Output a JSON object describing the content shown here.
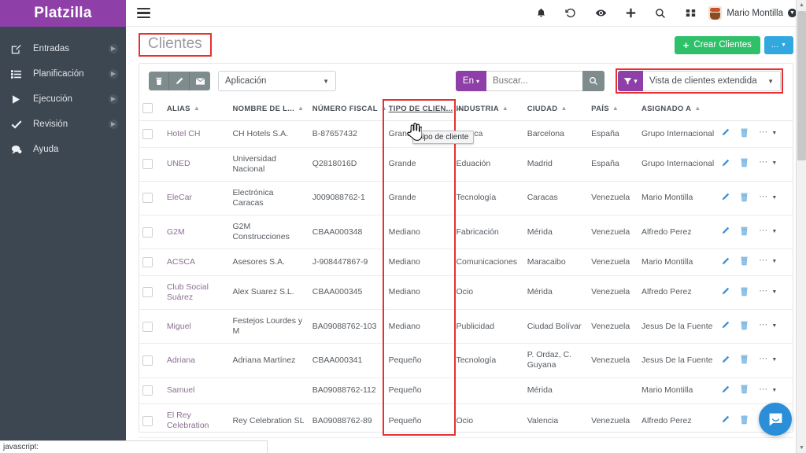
{
  "brand": {
    "logo": "Platzilla"
  },
  "sidebar": {
    "items": [
      {
        "label": "Entradas",
        "icon": "edit-square-icon",
        "has_arrow": true
      },
      {
        "label": "Planificación",
        "icon": "list-icon",
        "has_arrow": true
      },
      {
        "label": "Ejecución",
        "icon": "play-icon",
        "has_arrow": true
      },
      {
        "label": "Revisión",
        "icon": "check-icon",
        "has_arrow": true
      },
      {
        "label": "Ayuda",
        "icon": "chat-bubble-icon",
        "has_arrow": false
      }
    ]
  },
  "topbar": {
    "menu_icon": "hamburger-icon",
    "icons": [
      "bell-icon",
      "history-icon",
      "eye-icon",
      "plus-icon",
      "search-icon",
      "grid-icon"
    ],
    "username": "Mario Montilla",
    "avatar": "user-avatar"
  },
  "page": {
    "title": "Clientes",
    "create_button": "Crear Clientes",
    "create_more_button": "..."
  },
  "toolbar": {
    "delete_icon": "trash-icon",
    "edit_icon": "pencil-icon",
    "mail_icon": "envelope-icon",
    "app_select": "Aplicación",
    "lang_button": "En",
    "search_placeholder": "Buscar...",
    "search_value": "",
    "search_icon": "search-icon",
    "filter_icon": "funnel-icon",
    "view_select": "Vista de clientes extendida"
  },
  "table": {
    "columns": [
      {
        "key": "check",
        "label": "",
        "sortable": false
      },
      {
        "key": "alias",
        "label": "ALIAS",
        "sortable": true
      },
      {
        "key": "nombre",
        "label": "NOMBRE DE L...",
        "sortable": true
      },
      {
        "key": "fiscal",
        "label": "NÚMERO FISCAL",
        "sortable": true
      },
      {
        "key": "tipo",
        "label": "TIPO DE CLIEN...",
        "sortable": true
      },
      {
        "key": "industria",
        "label": "INDUSTRIA",
        "sortable": true
      },
      {
        "key": "ciudad",
        "label": "CIUDAD",
        "sortable": true
      },
      {
        "key": "pais",
        "label": "PAÍS",
        "sortable": true
      },
      {
        "key": "asignado",
        "label": "ASIGNADO A",
        "sortable": true
      }
    ],
    "rows": [
      {
        "alias": "Hotel CH",
        "nombre": "CH Hotels S.A.",
        "fiscal": "B-87657432",
        "tipo": "Grande",
        "industria": "Horeca",
        "ciudad": "Barcelona",
        "pais": "España",
        "asignado": "Grupo Internacional"
      },
      {
        "alias": "UNED",
        "nombre": "Universidad Nacional",
        "fiscal": "Q2818016D",
        "tipo": "Grande",
        "industria": "Eduación",
        "ciudad": "Madrid",
        "pais": "España",
        "asignado": "Grupo Internacional"
      },
      {
        "alias": "EleCar",
        "nombre": "Electrónica Caracas",
        "fiscal": "J009088762-1",
        "tipo": "Grande",
        "industria": "Tecnología",
        "ciudad": "Caracas",
        "pais": "Venezuela",
        "asignado": "Mario Montilla"
      },
      {
        "alias": "G2M",
        "nombre": "G2M Construcciones",
        "fiscal": "CBAA000348",
        "tipo": "Mediano",
        "industria": "Fabricación",
        "ciudad": "Mérida",
        "pais": "Venezuela",
        "asignado": "Alfredo Perez"
      },
      {
        "alias": "ACSCA",
        "nombre": "Asesores S.A.",
        "fiscal": "J-908447867-9",
        "tipo": "Mediano",
        "industria": "Comunicaciones",
        "ciudad": "Maracaibo",
        "pais": "Venezuela",
        "asignado": "Mario Montilla"
      },
      {
        "alias": "Club Social Suárez",
        "nombre": "Alex Suarez S.L.",
        "fiscal": "CBAA000345",
        "tipo": "Mediano",
        "industria": "Ocio",
        "ciudad": "Mérida",
        "pais": "Venezuela",
        "asignado": "Alfredo Perez"
      },
      {
        "alias": "Miguel",
        "nombre": "Festejos Lourdes y M",
        "fiscal": "BA09088762-103",
        "tipo": "Mediano",
        "industria": "Publicidad",
        "ciudad": "Ciudad Bolívar",
        "pais": "Venezuela",
        "asignado": "Jesus De la Fuente"
      },
      {
        "alias": "Adriana",
        "nombre": "Adriana Martínez",
        "fiscal": "CBAA000341",
        "tipo": "Pequeño",
        "industria": "Tecnología",
        "ciudad": "P. Ordaz, C. Guyana",
        "pais": "Venezuela",
        "asignado": "Jesus De la Fuente"
      },
      {
        "alias": "Samuel",
        "nombre": "",
        "fiscal": "BA09088762-112",
        "tipo": "Pequeño",
        "industria": "",
        "ciudad": "Mérida",
        "pais": "",
        "asignado": "Mario Montilla"
      },
      {
        "alias": "El Rey Celebration",
        "nombre": "Rey Celebration SL",
        "fiscal": "BA09088762-89",
        "tipo": "Pequeño",
        "industria": "Ocio",
        "ciudad": "Valencia",
        "pais": "Venezuela",
        "asignado": "Alfredo Perez"
      }
    ],
    "row_actions": {
      "edit_icon": "pencil-icon",
      "delete_icon": "trash-icon",
      "more_icon": "ellipsis-icon"
    }
  },
  "tooltip": {
    "text": "Tipo de cliente"
  },
  "statusbar": {
    "text": "javascript:"
  },
  "intercom": {
    "icon": "chat-icon"
  },
  "colors": {
    "brand_purple": "#8e3fa8",
    "sidebar_dark": "#3d4752",
    "highlight_red": "#e83030",
    "create_green": "#2fc06a",
    "info_blue": "#31a8e0",
    "action_blue": "#3b8fd6",
    "toolbar_gray": "#7f8c8d",
    "link_mauve": "#8b6f91"
  }
}
